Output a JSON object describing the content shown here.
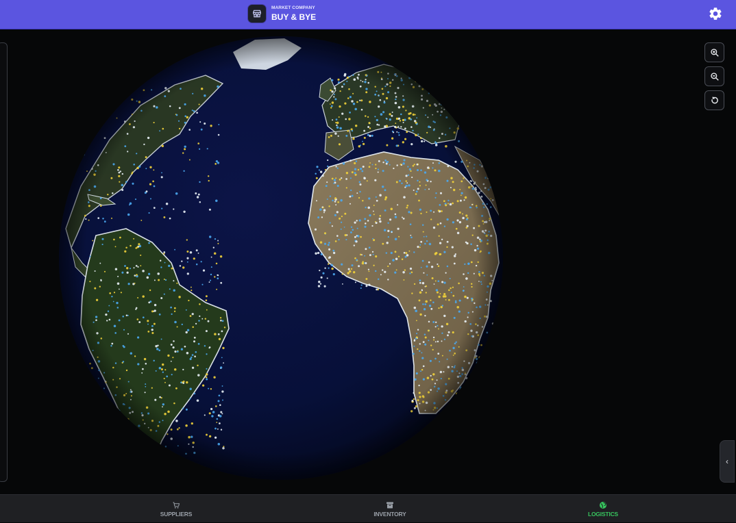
{
  "header": {
    "company_label": "MARKET COMPANY",
    "company_name": "BUY & BYE",
    "logo_icon": "storefront-icon",
    "settings_icon": "gear-icon",
    "accent_color": "#5b55e0"
  },
  "map": {
    "view": "3d-globe",
    "controls": [
      {
        "name": "zoom-in",
        "icon": "zoom-in-icon"
      },
      {
        "name": "zoom-out",
        "icon": "zoom-out-icon"
      },
      {
        "name": "reset-rotation",
        "icon": "rotate-icon"
      }
    ],
    "drawer_toggle_icon": "‹",
    "point_colors": [
      "#f1d23b",
      "#4aa8f0",
      "#e9f1f6"
    ]
  },
  "bottom_nav": {
    "items": [
      {
        "label": "SUPPLIERS",
        "icon": "cart-icon",
        "active": false
      },
      {
        "label": "INVENTORY",
        "icon": "archive-box-icon",
        "active": false
      },
      {
        "label": "LOGISTICS",
        "icon": "globe-icon",
        "active": true
      }
    ],
    "active_color": "#37c45e"
  }
}
